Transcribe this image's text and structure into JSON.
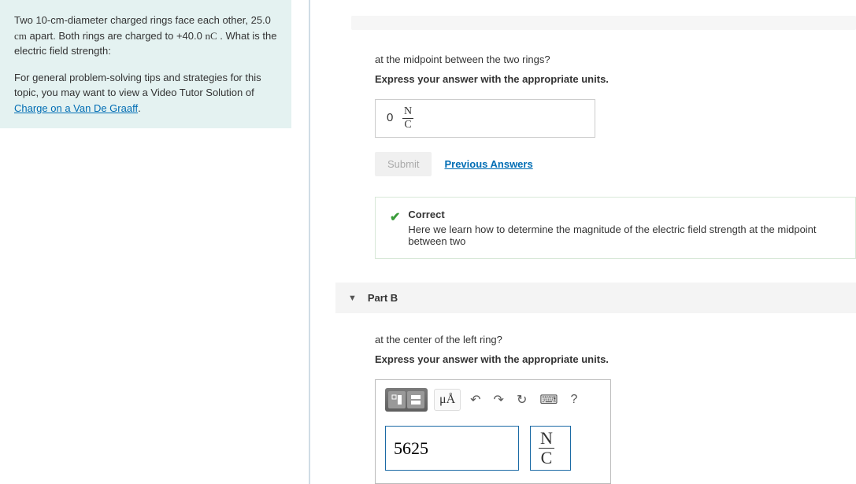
{
  "problem": {
    "statement_before_unit": "Two 10-cm-diameter charged rings face each other, 25.0 ",
    "unit1": "cm",
    "statement_mid": " apart. Both rings are charged to +40.0 ",
    "unit2": "nC",
    "statement_after": " . What is the electric field strength:",
    "tips_prefix": "For general problem-solving tips and strategies for this topic, you may want to view a Video Tutor Solution of ",
    "tips_link": "Charge on a Van De Graaff",
    "tips_suffix": "."
  },
  "partA": {
    "question": "at the midpoint between the two rings?",
    "instruction": "Express your answer with the appropriate units.",
    "answer_value": "0",
    "answer_unit_num": "N",
    "answer_unit_den": "C",
    "submit_label": "Submit",
    "prev_label": "Previous Answers",
    "feedback_title": "Correct",
    "feedback_text": "Here we learn how to determine the magnitude of the electric field strength at the midpoint between two"
  },
  "partB": {
    "header": "Part B",
    "question": "at the center of the left ring?",
    "instruction": "Express your answer with the appropriate units.",
    "toolbar_units": "μÅ",
    "value": "5625",
    "unit_num": "N",
    "unit_den": "C",
    "help_label": "?"
  }
}
